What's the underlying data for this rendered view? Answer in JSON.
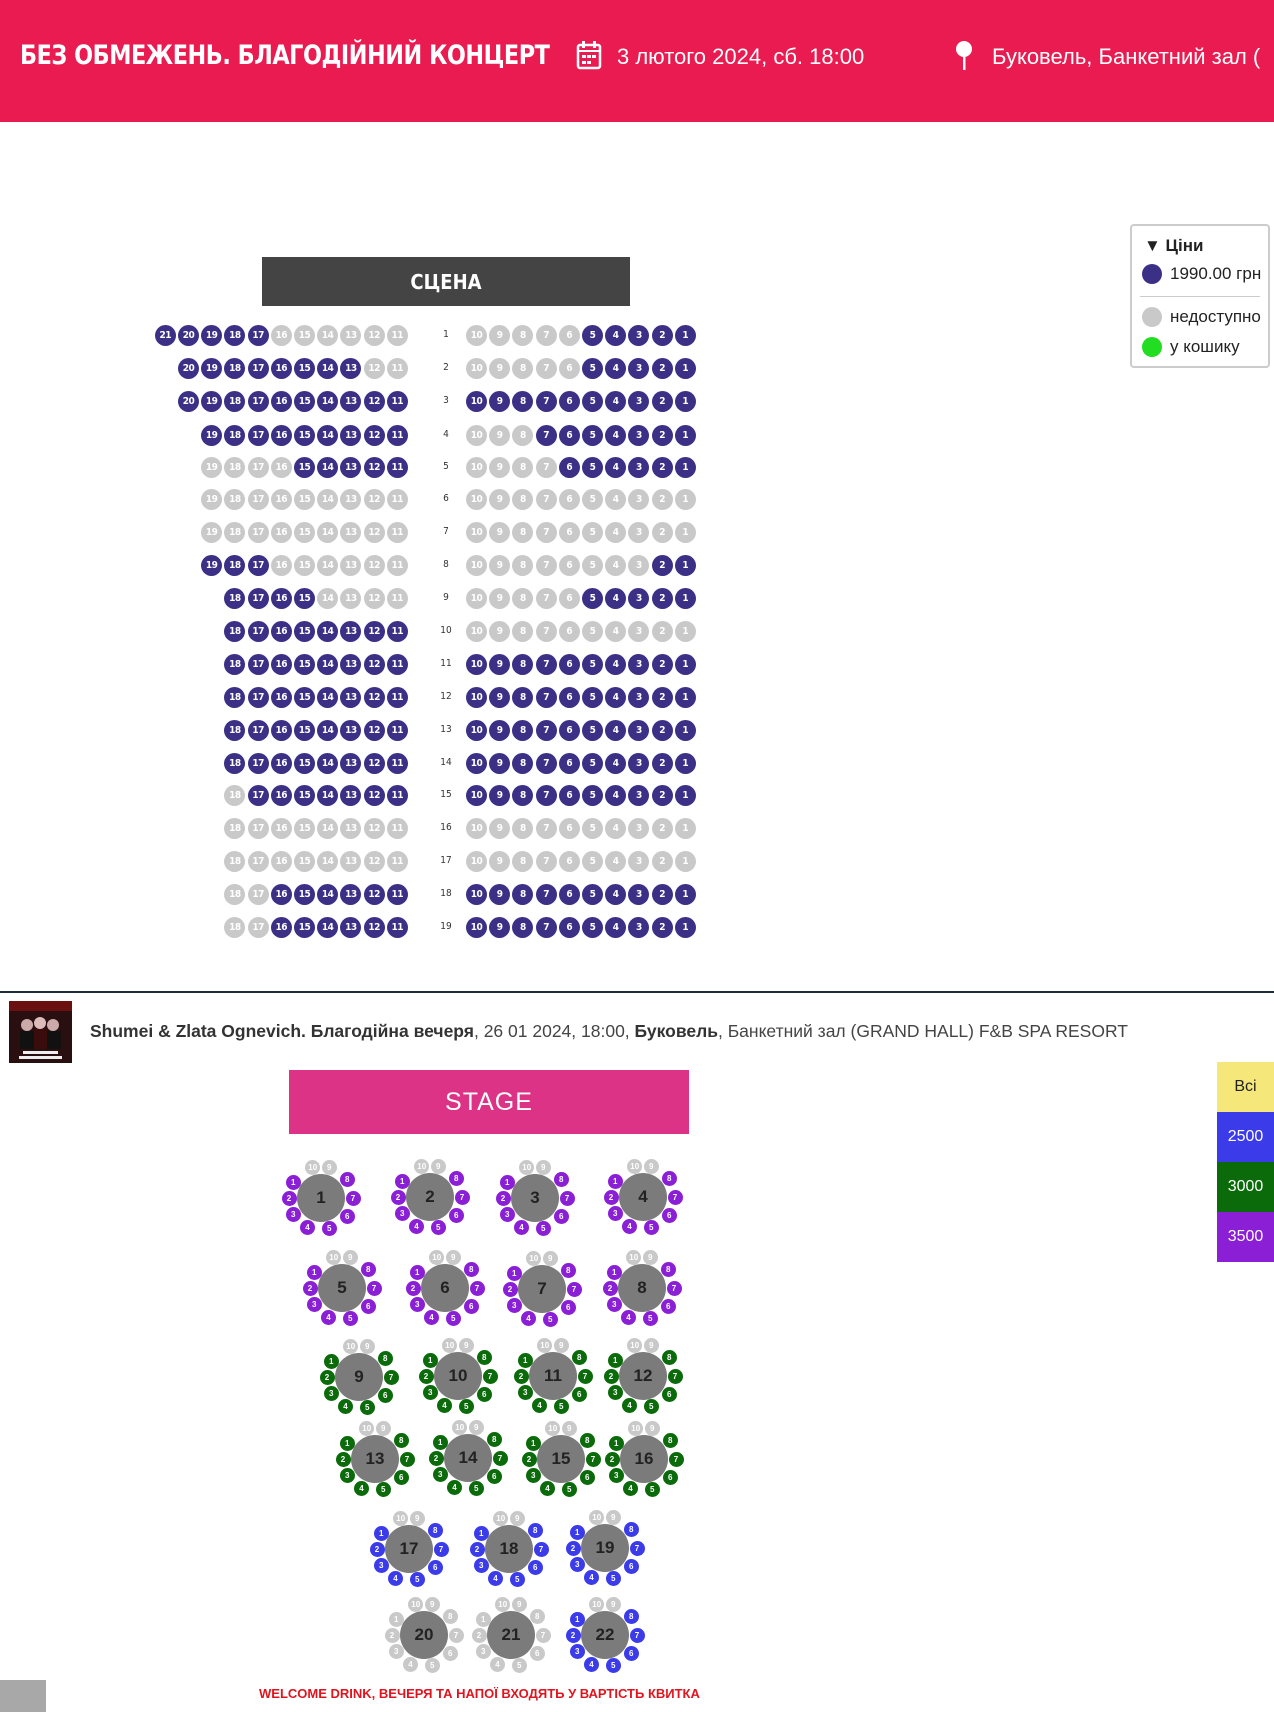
{
  "header": {
    "title": "БЕЗ ОБМЕЖЕНЬ. БЛАГОДІЙНИЙ КОНЦЕРТ",
    "date": "3 лютого 2024, сб. 18:00",
    "venue": "Буковель, Банкетний зал (",
    "calendar_icon": "calendar-icon",
    "pin_icon": "map-pin-icon"
  },
  "stage_label": "СЦЕНА",
  "legend": {
    "title": "▼ Ціни",
    "price": "1990.00 грн",
    "unavailable": "недоступно",
    "in_cart": "у кошику",
    "colors": {
      "available": "#3b2f86",
      "unavailable": "#c9c9c9",
      "in_cart": "#22dd22"
    }
  },
  "seat_rows": [
    {
      "row": "1",
      "left": [
        21,
        20,
        19,
        18,
        17,
        16,
        15,
        14,
        13,
        12,
        11
      ],
      "left_avail": [
        21,
        20,
        19,
        18,
        17
      ],
      "right_avail": [
        5,
        4,
        3,
        2,
        1
      ]
    },
    {
      "row": "2",
      "left": [
        20,
        19,
        18,
        17,
        16,
        15,
        14,
        13,
        12,
        11
      ],
      "left_avail": [
        20,
        19,
        18,
        17,
        16,
        15,
        14,
        13
      ],
      "right_avail": [
        5,
        4,
        3,
        2,
        1
      ]
    },
    {
      "row": "3",
      "left": [
        20,
        19,
        18,
        17,
        16,
        15,
        14,
        13,
        12,
        11
      ],
      "left_avail": [
        20,
        19,
        18,
        17,
        16,
        15,
        14,
        13,
        12,
        11
      ],
      "right_avail": [
        10,
        9,
        8,
        7,
        6,
        5,
        4,
        3,
        2,
        1
      ]
    },
    {
      "row": "4",
      "left": [
        19,
        18,
        17,
        16,
        15,
        14,
        13,
        12,
        11
      ],
      "left_avail": [
        19,
        18,
        17,
        16,
        15,
        14,
        13,
        12,
        11
      ],
      "right_avail": [
        7,
        6,
        5,
        4,
        3,
        2,
        1
      ]
    },
    {
      "row": "5",
      "left": [
        19,
        18,
        17,
        16,
        15,
        14,
        13,
        12,
        11
      ],
      "left_avail": [
        15,
        14,
        13,
        12,
        11
      ],
      "right_avail": [
        6,
        5,
        4,
        3,
        2,
        1
      ]
    },
    {
      "row": "6",
      "left": [
        19,
        18,
        17,
        16,
        15,
        14,
        13,
        12,
        11
      ],
      "left_avail": [],
      "right_avail": []
    },
    {
      "row": "7",
      "left": [
        19,
        18,
        17,
        16,
        15,
        14,
        13,
        12,
        11
      ],
      "left_avail": [],
      "right_avail": []
    },
    {
      "row": "8",
      "left": [
        19,
        18,
        17,
        16,
        15,
        14,
        13,
        12,
        11
      ],
      "left_avail": [
        19,
        18,
        17
      ],
      "right_avail": [
        2,
        1
      ]
    },
    {
      "row": "9",
      "left": [
        18,
        17,
        16,
        15,
        14,
        13,
        12,
        11
      ],
      "left_avail": [
        18,
        17,
        16,
        15
      ],
      "right_avail": [
        5,
        4,
        3,
        2,
        1
      ]
    },
    {
      "row": "10",
      "left": [
        18,
        17,
        16,
        15,
        14,
        13,
        12,
        11
      ],
      "left_avail": [
        18,
        17,
        16,
        15,
        14,
        13,
        12,
        11
      ],
      "right_avail": []
    },
    {
      "row": "11",
      "left": [
        18,
        17,
        16,
        15,
        14,
        13,
        12,
        11
      ],
      "left_avail": [
        18,
        17,
        16,
        15,
        14,
        13,
        12,
        11
      ],
      "right_avail": [
        10,
        9,
        8,
        7,
        6,
        5,
        4,
        3,
        2,
        1
      ]
    },
    {
      "row": "12",
      "left": [
        18,
        17,
        16,
        15,
        14,
        13,
        12,
        11
      ],
      "left_avail": [
        18,
        17,
        16,
        15,
        14,
        13,
        12,
        11
      ],
      "right_avail": [
        10,
        9,
        8,
        7,
        6,
        5,
        4,
        3,
        2,
        1
      ]
    },
    {
      "row": "13",
      "left": [
        18,
        17,
        16,
        15,
        14,
        13,
        12,
        11
      ],
      "left_avail": [
        18,
        17,
        16,
        15,
        14,
        13,
        12,
        11
      ],
      "right_avail": [
        10,
        9,
        8,
        7,
        6,
        5,
        4,
        3,
        2,
        1
      ]
    },
    {
      "row": "14",
      "left": [
        18,
        17,
        16,
        15,
        14,
        13,
        12,
        11
      ],
      "left_avail": [
        18,
        17,
        16,
        15,
        14,
        13,
        12,
        11
      ],
      "right_avail": [
        10,
        9,
        8,
        7,
        6,
        5,
        4,
        3,
        2,
        1
      ]
    },
    {
      "row": "15",
      "left": [
        18,
        17,
        16,
        15,
        14,
        13,
        12,
        11
      ],
      "left_avail": [
        17,
        16,
        15,
        14,
        13,
        12,
        11
      ],
      "right_avail": [
        10,
        9,
        8,
        7,
        6,
        5,
        4,
        3,
        2,
        1
      ]
    },
    {
      "row": "16",
      "left": [
        18,
        17,
        16,
        15,
        14,
        13,
        12,
        11
      ],
      "left_avail": [],
      "right_avail": []
    },
    {
      "row": "17",
      "left": [
        18,
        17,
        16,
        15,
        14,
        13,
        12,
        11
      ],
      "left_avail": [],
      "right_avail": []
    },
    {
      "row": "18",
      "left": [
        18,
        17,
        16,
        15,
        14,
        13,
        12,
        11
      ],
      "left_avail": [
        16,
        15,
        14,
        13,
        12,
        11
      ],
      "right_avail": [
        10,
        9,
        8,
        7,
        6,
        5,
        4,
        3,
        2,
        1
      ]
    },
    {
      "row": "19",
      "left": [
        18,
        17,
        16,
        15,
        14,
        13,
        12,
        11
      ],
      "left_avail": [
        16,
        15,
        14,
        13,
        12,
        11
      ],
      "right_avail": [
        10,
        9,
        8,
        7,
        6,
        5,
        4,
        3,
        2,
        1
      ]
    }
  ],
  "right_numbers": [
    10,
    9,
    8,
    7,
    6,
    5,
    4,
    3,
    2,
    1
  ],
  "event2": {
    "name": "Shumei & Zlata Ognevich. Благодійна вечеря",
    "date": ", 26 01 2024, 18:00, ",
    "city": "Буковель",
    "venue": ", Банкетний зал (GRAND HALL) F&B SPA RESORT",
    "stage_label": "STAGE",
    "note": "WELCOME DRINK, ВЕЧЕРЯ ТА НАПОЇ ВХОДЯТЬ У ВАРТІСТЬ КВИТКА"
  },
  "price_filters": [
    {
      "label": "Всі",
      "bg": "#f5e77a",
      "color": "#222"
    },
    {
      "label": "2500",
      "bg": "#3b3bea",
      "color": "#fff"
    },
    {
      "label": "3000",
      "bg": "#0b6b0b",
      "color": "#fff"
    },
    {
      "label": "3500",
      "bg": "#8a1fd6",
      "color": "#fff"
    }
  ],
  "table_colors": {
    "3500": "#8a1fd6",
    "3000": "#0b6b0b",
    "2500": "#3b3bea",
    "na": "#c9c9c9"
  },
  "tables": [
    {
      "n": "1",
      "tier": "3500"
    },
    {
      "n": "2",
      "tier": "3500"
    },
    {
      "n": "3",
      "tier": "3500"
    },
    {
      "n": "4",
      "tier": "3500"
    },
    {
      "n": "5",
      "tier": "3500"
    },
    {
      "n": "6",
      "tier": "3500"
    },
    {
      "n": "7",
      "tier": "3500"
    },
    {
      "n": "8",
      "tier": "3500"
    },
    {
      "n": "9",
      "tier": "3000"
    },
    {
      "n": "10",
      "tier": "3000"
    },
    {
      "n": "11",
      "tier": "3000"
    },
    {
      "n": "12",
      "tier": "3000"
    },
    {
      "n": "13",
      "tier": "3000"
    },
    {
      "n": "14",
      "tier": "3000"
    },
    {
      "n": "15",
      "tier": "3000"
    },
    {
      "n": "16",
      "tier": "3000"
    },
    {
      "n": "17",
      "tier": "2500"
    },
    {
      "n": "18",
      "tier": "2500"
    },
    {
      "n": "19",
      "tier": "2500"
    },
    {
      "n": "20",
      "tier": "na"
    },
    {
      "n": "21",
      "tier": "na"
    },
    {
      "n": "22",
      "tier": "2500"
    }
  ]
}
